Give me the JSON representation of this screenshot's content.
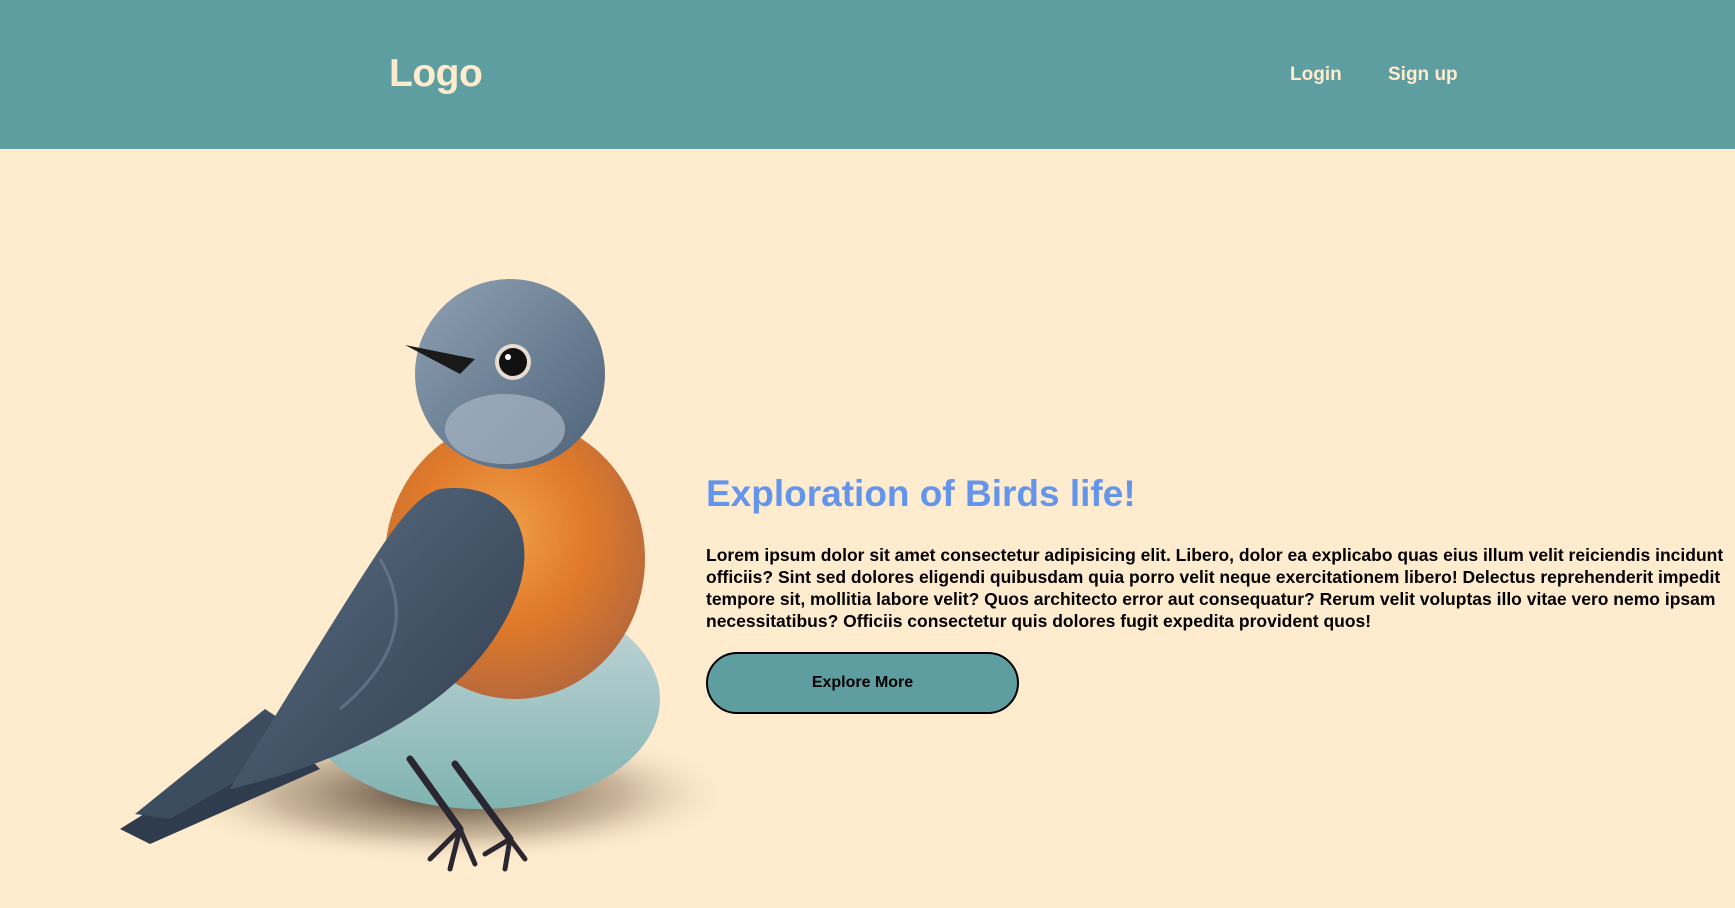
{
  "header": {
    "logo": "Logo",
    "nav": {
      "login": "Login",
      "signup": "Sign up"
    }
  },
  "hero": {
    "title": "Exploration of Birds life!",
    "body": "Lorem ipsum dolor sit amet consectetur adipisicing elit. Libero, dolor ea explicabo quas eius illum velit reiciendis incidunt officiis? Sint sed dolores eligendi quibusdam quia porro velit neque exercitationem libero! Delectus reprehenderit impedit tempore sit, mollitia labore velit? Quos architecto error aut consequatur? Rerum velit voluptas illo vitae vero nemo ipsam necessitatibus? Officiis consectetur quis dolores fugit expedita provident quos!",
    "cta": "Explore More",
    "image": "bluebird-illustration"
  },
  "colors": {
    "header_bg": "#5f9ea0",
    "page_bg": "#ffebcd",
    "title": "#6495ed",
    "header_text": "#ffebcd"
  }
}
